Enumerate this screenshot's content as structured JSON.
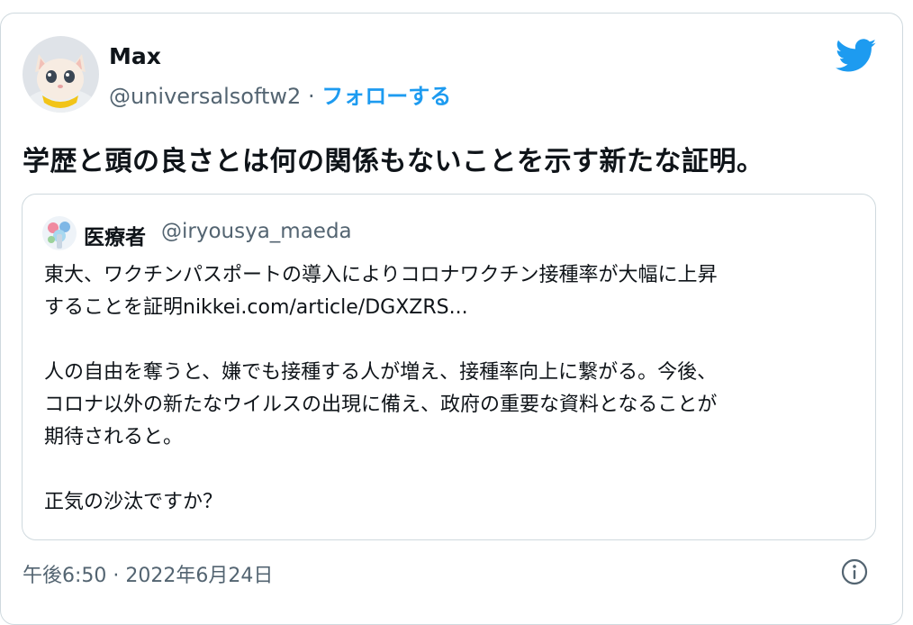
{
  "tweet": {
    "author_name": "Max",
    "author_handle": "@universalsoftw2",
    "separator": "·",
    "follow_label": "フォローする",
    "text": "学歴と頭の良さとは何の関係もないことを示す新たな証明。",
    "time": "午後6:50",
    "date": "2022年6月24日"
  },
  "quoted": {
    "author_name": "医療者",
    "author_handle": "@iryousya_maeda",
    "lines": [
      "東大、ワクチンパスポートの導入によりコロナワクチン接種率が大幅に上昇",
      "することを証明nikkei.com/article/DGXZRS...",
      "",
      "人の自由を奪うと、嫌でも接種する人が増え、接種率向上に繋がる。今後、",
      "コロナ以外の新たなウイルスの出現に備え、政府の重要な資料となることが",
      "期待されると。",
      "",
      "正気の沙汰ですか？"
    ]
  },
  "icons": {
    "brand": "twitter-bird-icon",
    "info": "info-icon"
  },
  "colors": {
    "accent": "#1d9bf0",
    "text": "#0f1419",
    "muted": "#536471",
    "border": "#cfd9de"
  }
}
